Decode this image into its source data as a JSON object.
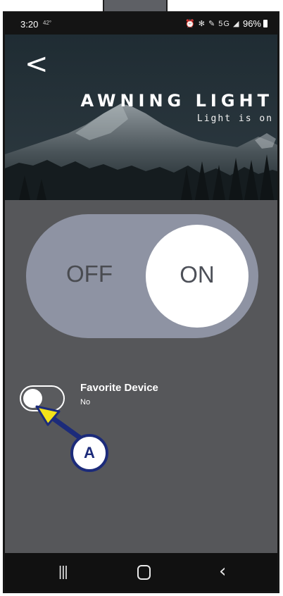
{
  "status_bar": {
    "time": "3:20",
    "temperature": "42°",
    "icons_text": "⏰ ✻ ✎ 5G ◢",
    "battery": "96%"
  },
  "header": {
    "back_icon": "chevron-left-icon",
    "title": "AWNING LIGHT",
    "subtitle": "Light is on"
  },
  "power_toggle": {
    "off_label": "OFF",
    "on_label": "ON",
    "state": "on"
  },
  "favorite": {
    "title": "Favorite Device",
    "value": "No",
    "enabled": false
  },
  "nav_bar": {
    "recents": "|||",
    "home_icon": "home-icon",
    "back": "‹"
  },
  "annotation": {
    "label": "A",
    "color": "#1c2b7a",
    "arrow_color": "#f2e11a"
  },
  "colors": {
    "content_bg": "#56575a",
    "toggle_track": "#8e93a3",
    "toggle_knob": "#ffffff"
  }
}
